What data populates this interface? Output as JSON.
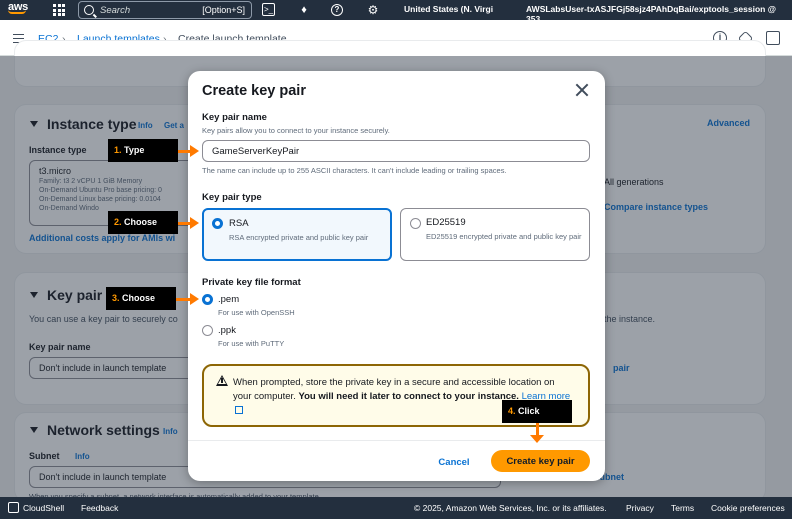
{
  "topnav": {
    "brand": "aws",
    "search_placeholder": "Search",
    "search_shortcut": "[Option+S]",
    "region": "United States (N. Virgi",
    "user": "AWSLabsUser-txASJFGj58sjz4PAhDqBai/exptools_session @ 353"
  },
  "breadcrumb": {
    "items": [
      "EC2",
      "Launch templates"
    ],
    "current": "Create launch template"
  },
  "background": {
    "instance_type": {
      "title": "Instance type",
      "info": "Info",
      "get_advice": "Get a",
      "advanced": "Advanced",
      "field_label": "Instance type",
      "value": "t3.micro",
      "specs": "Family: t3    2 vCPU    1 GiB Memory",
      "line1": "On-Demand Ubuntu Pro base pricing: 0",
      "line2": "On-Demand Linux base pricing: 0.0104",
      "line3": "On-Demand Windo",
      "all_generations": "All generations",
      "compare": "Compare instance types",
      "additional_costs": "Additional costs apply for AMIs wi"
    },
    "key_pair": {
      "title": "Key pair (",
      "desc": "You can use a key pair to securely co",
      "desc_tail": "the instance.",
      "field_label": "Key pair name",
      "value": "Don't include in launch template",
      "create_link": "pair"
    },
    "network": {
      "title": "Network settings",
      "info": "Info",
      "subnet_label": "Subnet",
      "subnet_info": "Info",
      "subnet_value": "Don't include in launch template",
      "create_subnet": "Create new subnet",
      "note": "When you specify a subnet, a network interface is automatically added to your template."
    }
  },
  "modal": {
    "title": "Create key pair",
    "name_label": "Key pair name",
    "name_desc": "Key pairs allow you to connect to your instance securely.",
    "name_value": "GameServerKeyPair",
    "name_hint": "The name can include up to 255 ASCII characters. It can't include leading or trailing spaces.",
    "type_label": "Key pair type",
    "types": [
      {
        "title": "RSA",
        "desc": "RSA encrypted private and public key pair",
        "selected": true
      },
      {
        "title": "ED25519",
        "desc": "ED25519 encrypted private and public key pair",
        "selected": false
      }
    ],
    "format_label": "Private key file format",
    "formats": [
      {
        "title": ".pem",
        "desc": "For use with OpenSSH",
        "selected": true
      },
      {
        "title": ".ppk",
        "desc": "For use with PuTTY",
        "selected": false
      }
    ],
    "alert": {
      "text": "When prompted, store the private key in a secure and accessible location on your computer.",
      "bold": "You will need it later to connect to your instance.",
      "link": "Learn more"
    },
    "cancel": "Cancel",
    "submit": "Create key pair"
  },
  "callouts": [
    {
      "num": "1.",
      "label": "Type"
    },
    {
      "num": "2.",
      "label": "Choose"
    },
    {
      "num": "3.",
      "label": "Choose"
    },
    {
      "num": "4.",
      "label": "Click"
    }
  ],
  "footer": {
    "cloudshell": "CloudShell",
    "feedback": "Feedback",
    "copyright": "© 2025, Amazon Web Services, Inc. or its affiliates.",
    "privacy": "Privacy",
    "terms": "Terms",
    "cookies": "Cookie preferences"
  },
  "colors": {
    "nav": "#232f3e",
    "primary": "#ff9900",
    "link": "#0972d3",
    "arrow": "#ff7a00"
  }
}
